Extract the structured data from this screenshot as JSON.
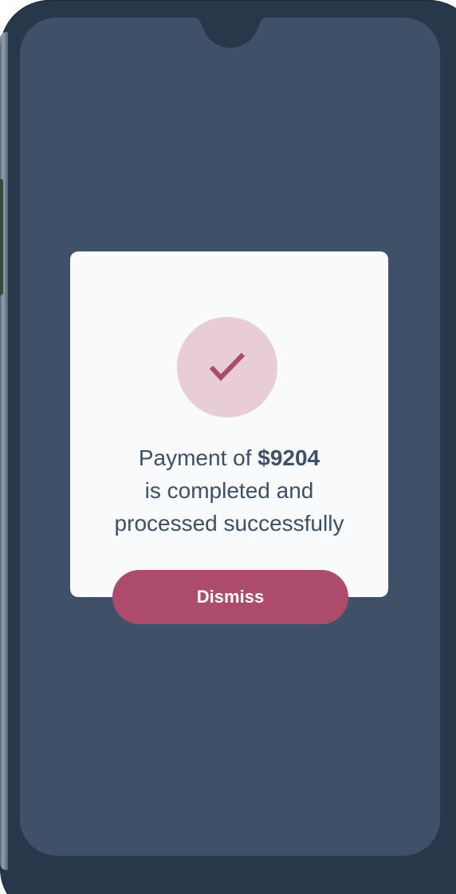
{
  "dialog": {
    "message_prefix": "Payment of ",
    "amount": "$9204",
    "message_line2": "is completed and",
    "message_line3": "processed successfully",
    "dismiss_label": "Dismiss",
    "icon": "checkmark-icon"
  },
  "colors": {
    "accent": "#ad4b6c",
    "badge_background": "#e8cdd9",
    "screen_background": "#3e5169",
    "card_background": "#f8fafc",
    "text": "#3d5068"
  }
}
